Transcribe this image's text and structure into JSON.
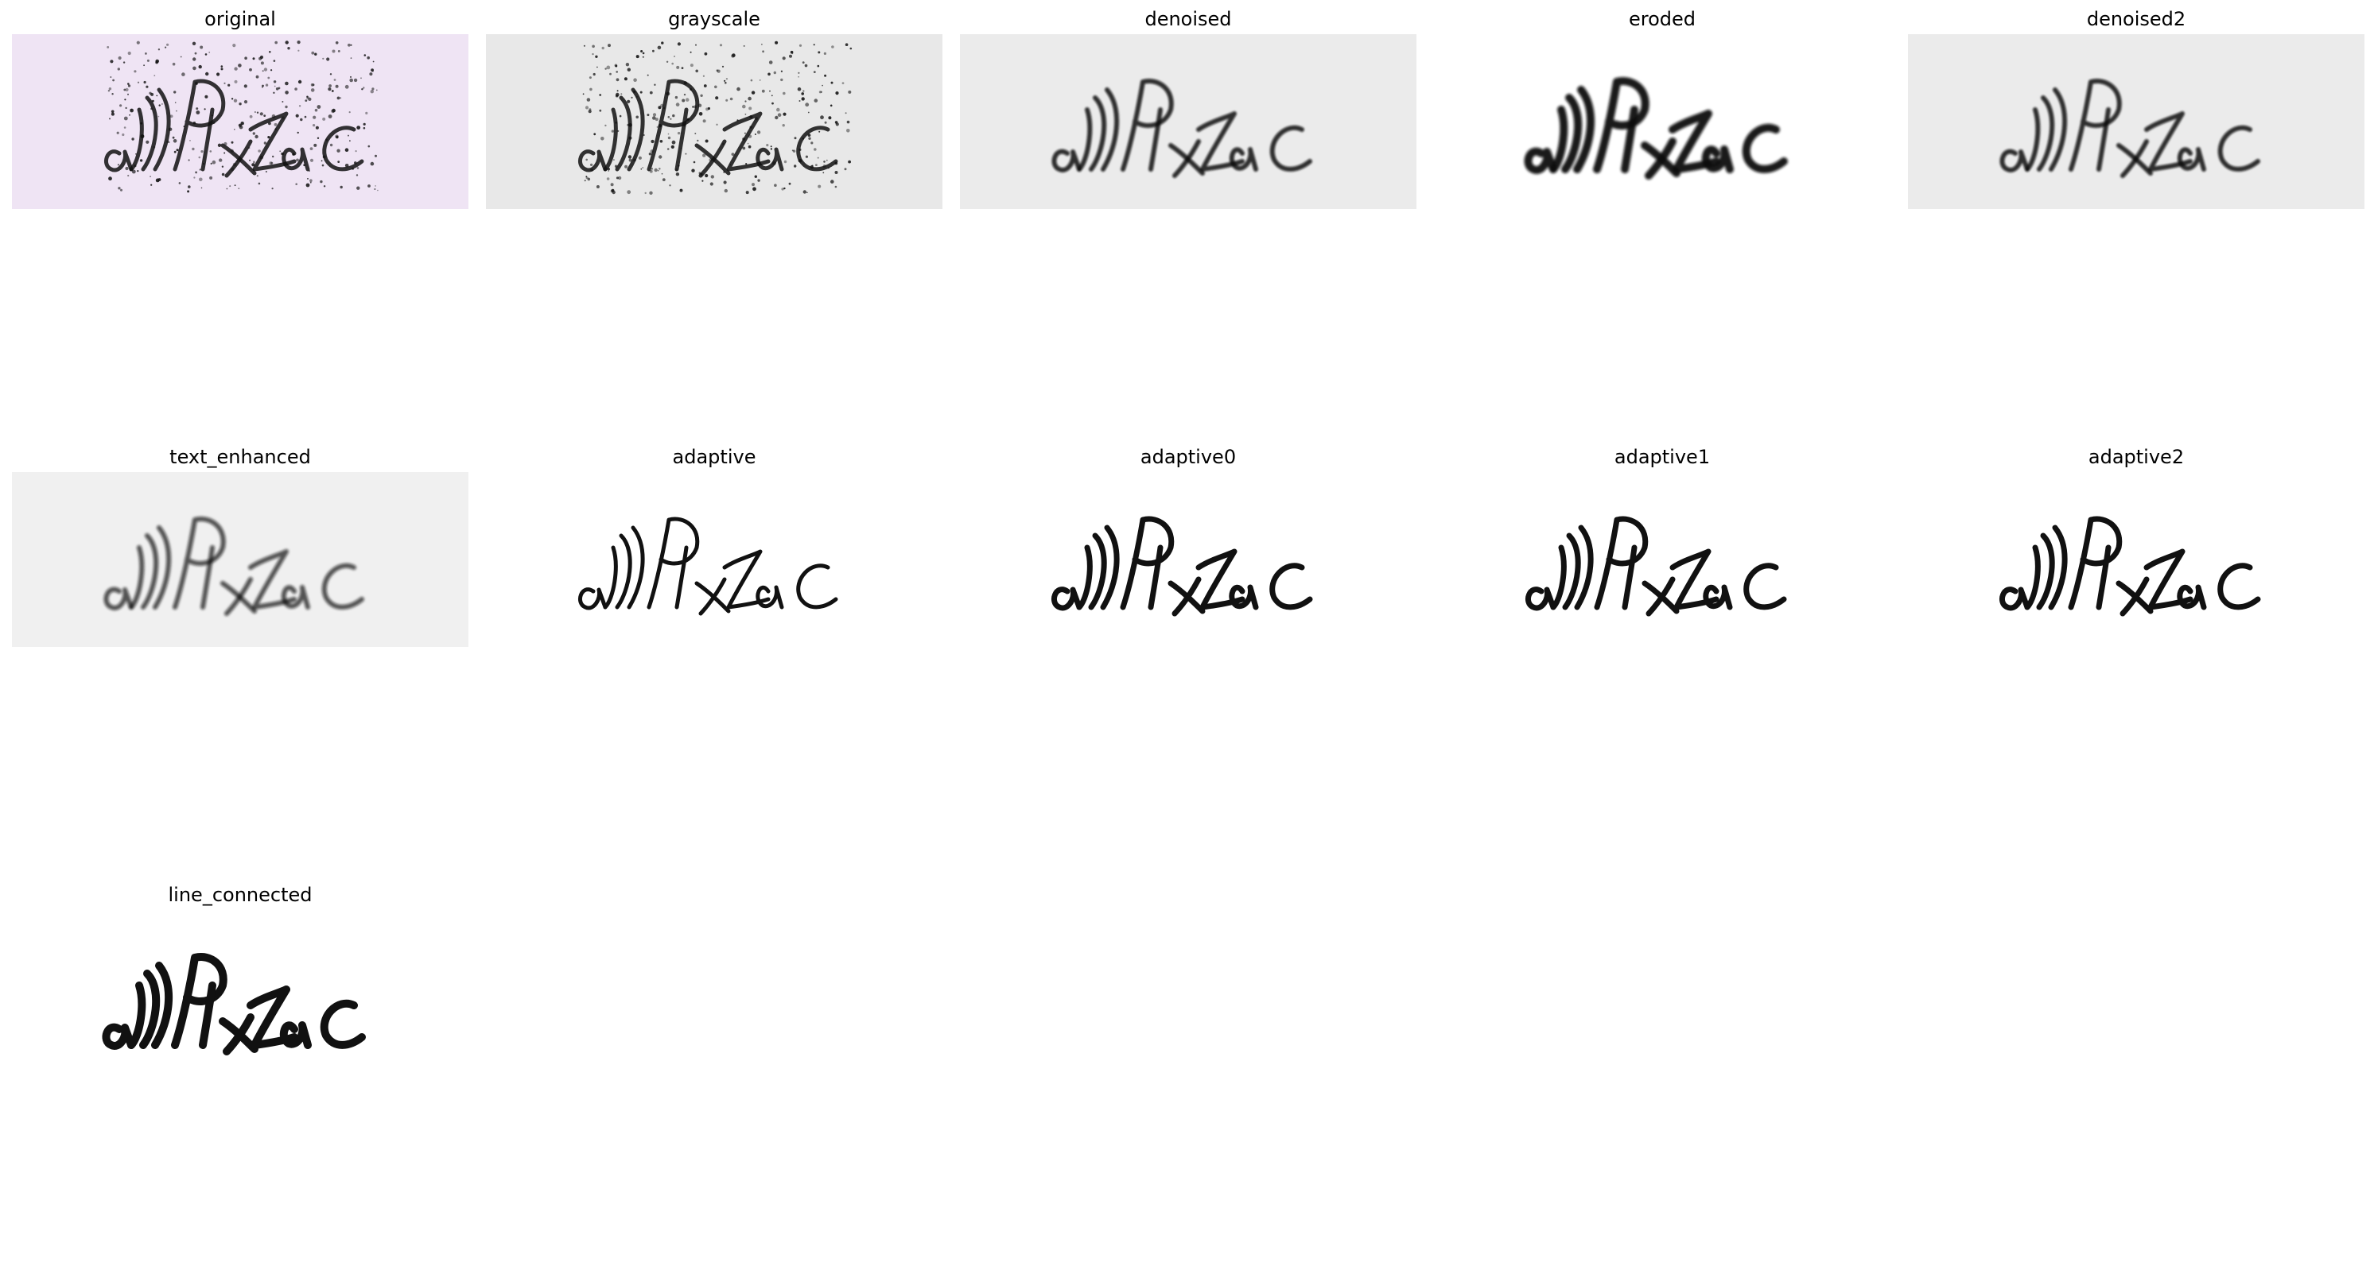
{
  "panels": [
    {
      "title": "original",
      "background": "#efe4f4"
    },
    {
      "title": "grayscale",
      "background": "#e8e8e8"
    },
    {
      "title": "denoised",
      "background": "#ebebeb"
    },
    {
      "title": "eroded",
      "background": "#ffffff"
    },
    {
      "title": "denoised2",
      "background": "#ebebeb"
    },
    {
      "title": "text_enhanced",
      "background": "#f0f0f0"
    },
    {
      "title": "adaptive",
      "background": "#ffffff"
    },
    {
      "title": "adaptive0",
      "background": "#ffffff"
    },
    {
      "title": "adaptive1",
      "background": "#ffffff"
    },
    {
      "title": "adaptive2",
      "background": "#ffffff"
    },
    {
      "title": "line_connected",
      "background": "#ffffff"
    }
  ],
  "ink_color": "#111111"
}
